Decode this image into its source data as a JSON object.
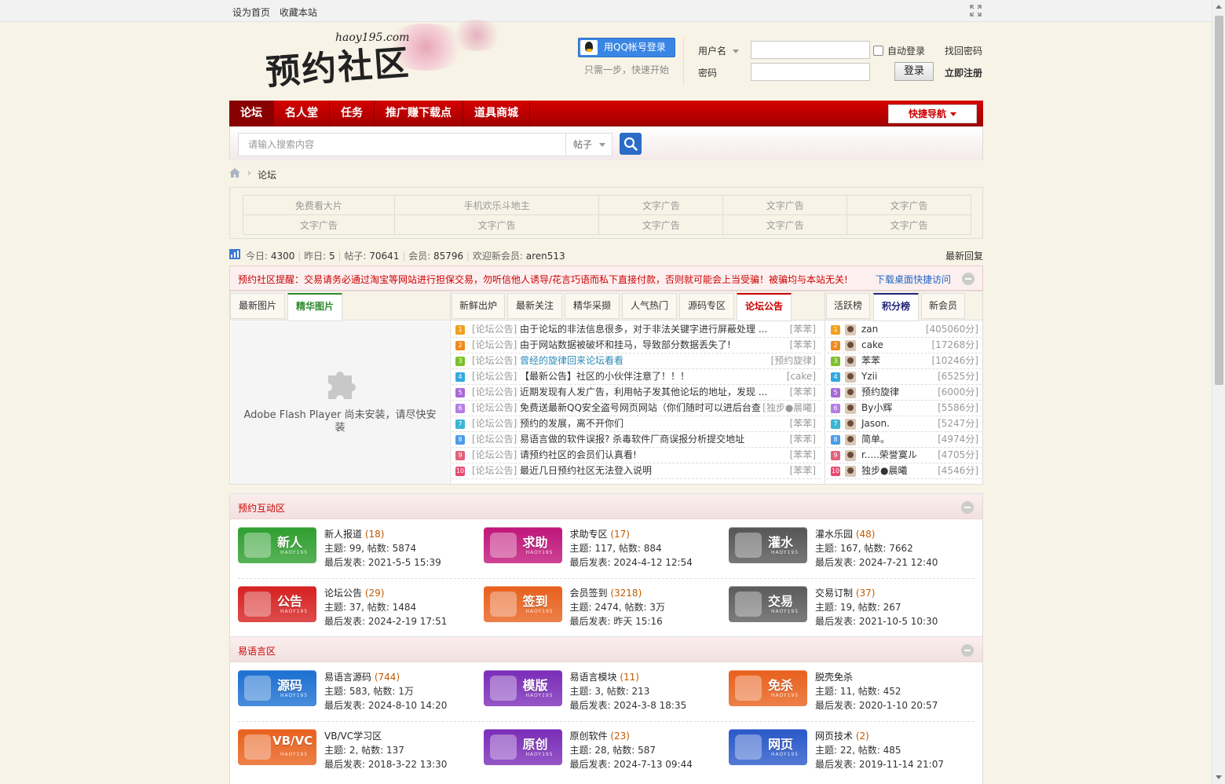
{
  "topbar": {
    "set_home": "设为首页",
    "bookmark": "收藏本站"
  },
  "header": {
    "logo_text": "预约社区",
    "logo_sub": "haoy195.com",
    "qq_login": "用QQ帐号登录",
    "qq_hint": "只需一步，快速开始",
    "username_label": "用户名",
    "password_label": "密码",
    "auto_login": "自动登录",
    "find_password": "找回密码",
    "login_button": "登录",
    "register": "立即注册"
  },
  "nav": {
    "items": [
      "论坛",
      "名人堂",
      "任务",
      "推广赚下载点",
      "道具商城"
    ],
    "quick": "快捷导航"
  },
  "search": {
    "placeholder": "请输入搜索内容",
    "type": "帖子"
  },
  "breadcrumb": {
    "current": "论坛"
  },
  "ads": [
    [
      "免费看大片",
      "手机欢乐斗地主",
      "文字广告",
      "文字广告",
      "文字广告"
    ],
    [
      "文字广告",
      "文字广告",
      "文字广告",
      "文字广告",
      "文字广告"
    ]
  ],
  "stats": {
    "today_label": "今日:",
    "today": "4300",
    "yesterday_label": "昨日:",
    "yesterday": "5",
    "posts_label": "帖子:",
    "posts": "70641",
    "members_label": "会员:",
    "members": "85796",
    "welcome_label": "欢迎新会员:",
    "new_member": "aren513",
    "latest_reply": "最新回复"
  },
  "notice": {
    "text": "预约社区提醒：交易请务必通过淘宝等网站进行担保交易，勿听信他人诱导/花言巧语而私下直接付款，否则就可能会上当受骗！被骗均与本站无关!",
    "download": "下载桌面快捷访问"
  },
  "portal": {
    "image_tabs": [
      "最新图片",
      "精华图片"
    ],
    "flash_msg": "Adobe Flash Player 尚未安装，请尽快安装",
    "post_tabs": [
      "新鲜出炉",
      "最新关注",
      "精华采撷",
      "人气热门",
      "源码专区",
      "论坛公告"
    ],
    "rank_tabs": [
      "活跃榜",
      "积分榜",
      "新会员"
    ],
    "posts": [
      {
        "n": "1",
        "cat": "[论坛公告]",
        "title": "由于论坛的非法信息很多，对于非法关键字进行屏蔽处理 ...",
        "author": "[苯苯]"
      },
      {
        "n": "2",
        "cat": "[论坛公告]",
        "title": "由于网站数据被破坏和挂马，导致部分数据丢失了!",
        "author": "[苯苯]"
      },
      {
        "n": "3",
        "cat": "[论坛公告]",
        "title": "曾经的旋律回来论坛看看",
        "author": "[预约旋律]",
        "highlight": true
      },
      {
        "n": "4",
        "cat": "[论坛公告]",
        "title": "【最新公告】社区的小伙伴注意了！！！",
        "author": "[cake]"
      },
      {
        "n": "5",
        "cat": "[论坛公告]",
        "title": "近期发现有人发广告，利用帖子发其他论坛的地址，发现 ...",
        "author": "[苯苯]"
      },
      {
        "n": "6",
        "cat": "[论坛公告]",
        "title": "免费送最新QQ安全盗号网页网站（你们随时可以进后台查",
        "author": "[独步●晨曦]"
      },
      {
        "n": "7",
        "cat": "[论坛公告]",
        "title": "预约的发展，离不开你们",
        "author": "[苯苯]"
      },
      {
        "n": "8",
        "cat": "[论坛公告]",
        "title": "易语言做的软件误报? 杀毒软件厂商误报分析提交地址",
        "author": "[苯苯]"
      },
      {
        "n": "9",
        "cat": "[论坛公告]",
        "title": "请预约社区的会员们认真看!",
        "author": "[苯苯]"
      },
      {
        "n": "10",
        "cat": "[论坛公告]",
        "title": "最近几日预约社区无法登入说明",
        "author": "[苯苯]"
      }
    ],
    "ranks": [
      {
        "n": "1",
        "name": "zan",
        "score": "[405060分]"
      },
      {
        "n": "2",
        "name": "cake",
        "score": "[17268分]"
      },
      {
        "n": "3",
        "name": "苯苯",
        "score": "[10246分]"
      },
      {
        "n": "4",
        "name": "Yzii",
        "score": "[6525分]"
      },
      {
        "n": "5",
        "name": "预约旋律",
        "score": "[6000分]"
      },
      {
        "n": "6",
        "name": "By小辉",
        "score": "[5586分]"
      },
      {
        "n": "7",
        "name": "Jason.",
        "score": "[5247分]"
      },
      {
        "n": "8",
        "name": "简单。",
        "score": "[4974分]"
      },
      {
        "n": "9",
        "name": "r.....荣誉寞ル",
        "score": "[4705分]"
      },
      {
        "n": "10",
        "name": "独步●晨曦",
        "score": "[4546分]"
      }
    ]
  },
  "sections": [
    {
      "title": "预约互动区",
      "forums": [
        {
          "icon": "新人",
          "name": "新人报道",
          "count": "(18)",
          "stats": "主题: 99, 帖数: 5874",
          "last": "最后发表: 2021-5-5 15:39",
          "color": "#2e9e2e"
        },
        {
          "icon": "求助",
          "name": "求助专区",
          "count": "(17)",
          "stats": "主题: 117, 帖数: 884",
          "last": "最后发表: 2024-4-12 12:54",
          "color": "#c0147a"
        },
        {
          "icon": "灌水",
          "name": "灌水乐园",
          "count": "(48)",
          "stats": "主题: 167, 帖数: 7662",
          "last": "最后发表: 2024-7-21 12:40",
          "color": "#555555"
        },
        {
          "icon": "公告",
          "name": "论坛公告",
          "count": "(29)",
          "stats": "主题: 37, 帖数: 1484",
          "last": "最后发表: 2024-2-19 17:51",
          "color": "#d62020"
        },
        {
          "icon": "签到",
          "name": "会员签到",
          "count": "(3218)",
          "stats": "主题: 2474, 帖数: 3万",
          "last": "最后发表: 昨天 15:16",
          "color": "#e8601c"
        },
        {
          "icon": "交易",
          "name": "交易订制",
          "count": "(37)",
          "stats": "主题: 19, 帖数: 267",
          "last": "最后发表: 2021-10-5 10:30",
          "color": "#5b5b5b"
        }
      ]
    },
    {
      "title": "易语言区",
      "forums": [
        {
          "icon": "源码",
          "name": "易语言源码",
          "count": "(744)",
          "stats": "主题: 583, 帖数: 1万",
          "last": "最后发表: 2024-8-10 14:20",
          "color": "#1b6fd1"
        },
        {
          "icon": "模版",
          "name": "易语言模块",
          "count": "(11)",
          "stats": "主题: 3, 帖数: 213",
          "last": "最后发表: 2024-3-8 18:35",
          "color": "#7a2cb8"
        },
        {
          "icon": "免杀",
          "name": "脱壳免杀",
          "count": "",
          "stats": "主题: 11, 帖数: 452",
          "last": "最后发表: 2020-1-10 20:57",
          "color": "#e8601c"
        },
        {
          "icon": "VB/VC",
          "name": "VB/VC学习区",
          "count": "",
          "stats": "主题: 2, 帖数: 137",
          "last": "最后发表: 2018-3-22 13:30",
          "color": "#e8601c"
        },
        {
          "icon": "原创",
          "name": "原创软件",
          "count": "(23)",
          "stats": "主题: 28, 帖数: 587",
          "last": "最后发表: 2024-7-13 09:44",
          "color": "#7a2cb8"
        },
        {
          "icon": "网页",
          "name": "网页技术",
          "count": "(2)",
          "stats": "主题: 22, 帖数: 485",
          "last": "最后发表: 2019-11-14 21:07",
          "color": "#2958c9"
        }
      ]
    }
  ],
  "icon_brand": "HAOY195",
  "colors": {
    "nav_red": "#c40000",
    "accent_blue": "#2a6cc8",
    "rank_colors": [
      "#f0a020",
      "#f08a1e",
      "#7cc12c",
      "#33a8e0",
      "#a86ad8",
      "#b57ee6",
      "#3ab6d4",
      "#4a9de8",
      "#e0637a",
      "#e84a6e"
    ]
  }
}
